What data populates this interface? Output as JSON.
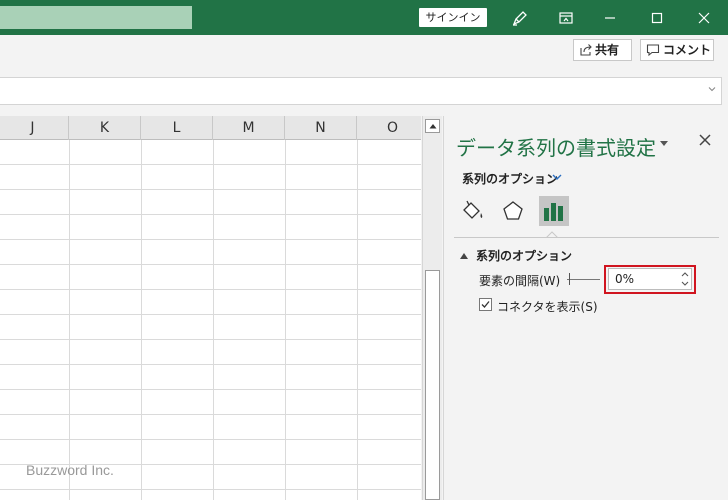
{
  "titlebar": {
    "signin_label": "サインイン"
  },
  "ribbon": {
    "share_label": "共有",
    "comment_label": "コメント"
  },
  "grid": {
    "columns": [
      "J",
      "K",
      "L",
      "M",
      "N",
      "O"
    ]
  },
  "watermark": "Buzzword Inc.",
  "pane": {
    "title": "データ系列の書式設定",
    "options_menu_label": "系列のオプション",
    "section_title": "系列のオプション",
    "gap_width_label": "要素の間隔(W)",
    "gap_width_value": "0%",
    "show_connector_label": "コネクタを表示(S)",
    "show_connector_checked": true
  },
  "colors": {
    "brand": "#217346",
    "highlight": "#d0141f"
  }
}
